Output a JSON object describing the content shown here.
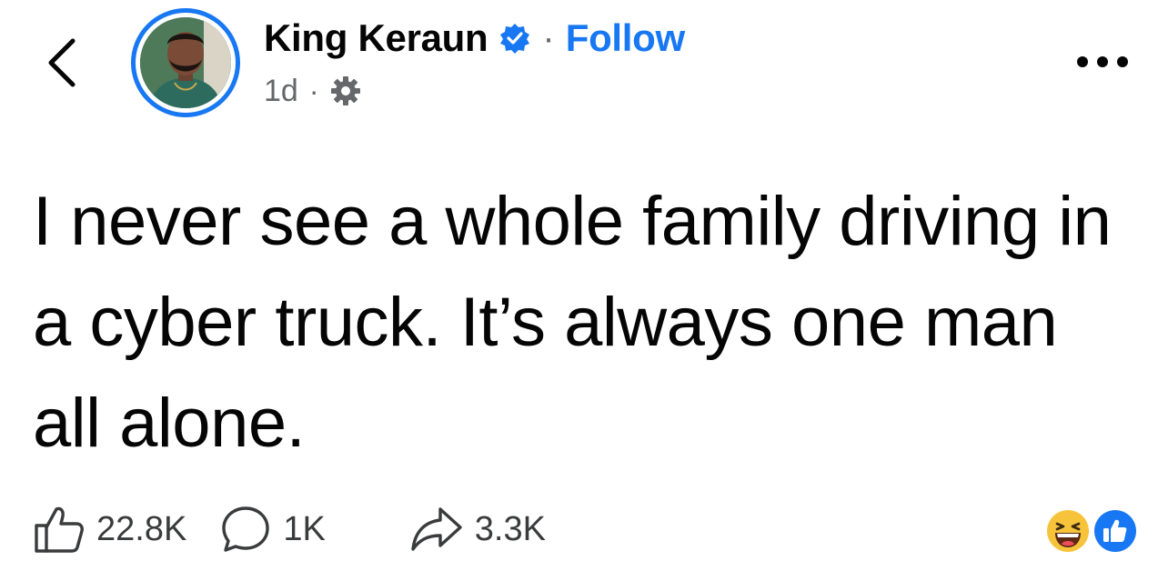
{
  "header": {
    "back_icon": "chevron-left-icon",
    "author_name": "King Keraun",
    "verified_icon": "verified-badge-icon",
    "separator": "·",
    "follow_label": "Follow",
    "timestamp": "1d",
    "audience_icon": "public-gear-icon",
    "more_icon": "more-horizontal-icon"
  },
  "post": {
    "text": "I never see a whole family driving in a cyber truck. It’s always one man all alone."
  },
  "actions": {
    "like": {
      "icon": "thumbs-up-icon",
      "count": "22.8K"
    },
    "comment": {
      "icon": "comment-bubble-icon",
      "count": "1K"
    },
    "share": {
      "icon": "share-arrow-icon",
      "count": "3.3K"
    }
  },
  "reactions": [
    {
      "name": "haha",
      "icon": "laughing-face-icon"
    },
    {
      "name": "like",
      "icon": "like-reaction-icon"
    }
  ],
  "colors": {
    "brand_blue": "#1877f2",
    "text_primary": "#050505",
    "text_secondary": "#65676b"
  }
}
